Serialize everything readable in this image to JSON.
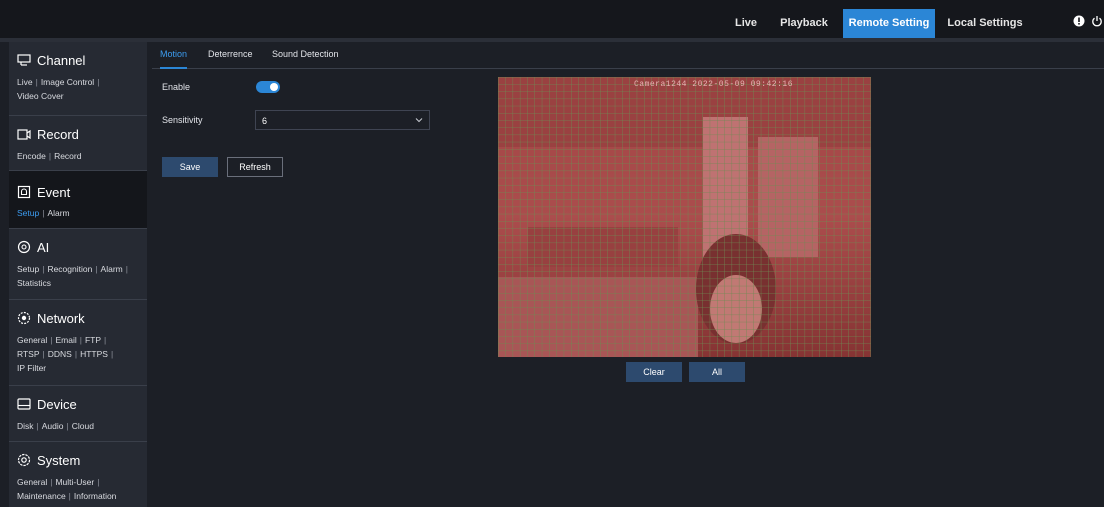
{
  "top_nav": {
    "items": [
      {
        "label": "Live",
        "active": false
      },
      {
        "label": "Playback",
        "active": false
      },
      {
        "label": "Remote Setting",
        "active": true
      },
      {
        "label": "Local Settings",
        "active": false
      }
    ],
    "icons": [
      "info-icon",
      "power-icon"
    ]
  },
  "sidebar": {
    "sections": [
      {
        "title": "Channel",
        "icon": "channel-icon",
        "links": [
          {
            "label": "Live",
            "active": false
          },
          {
            "label": "Image Control",
            "active": false
          },
          {
            "label": "Video Cover",
            "active": false
          }
        ]
      },
      {
        "title": "Record",
        "icon": "record-icon",
        "links": [
          {
            "label": "Encode",
            "active": false
          },
          {
            "label": "Record",
            "active": false
          }
        ]
      },
      {
        "title": "Event",
        "icon": "event-icon",
        "active": true,
        "links": [
          {
            "label": "Setup",
            "active": true
          },
          {
            "label": "Alarm",
            "active": false
          }
        ]
      },
      {
        "title": "AI",
        "icon": "ai-icon",
        "links": [
          {
            "label": "Setup",
            "active": false
          },
          {
            "label": "Recognition",
            "active": false
          },
          {
            "label": "Alarm",
            "active": false
          },
          {
            "label": "Statistics",
            "active": false
          }
        ]
      },
      {
        "title": "Network",
        "icon": "network-icon",
        "links": [
          {
            "label": "General",
            "active": false
          },
          {
            "label": "Email",
            "active": false
          },
          {
            "label": "FTP",
            "active": false
          },
          {
            "label": "RTSP",
            "active": false
          },
          {
            "label": "DDNS",
            "active": false
          },
          {
            "label": "HTTPS",
            "active": false
          },
          {
            "label": "IP Filter",
            "active": false
          }
        ]
      },
      {
        "title": "Device",
        "icon": "device-icon",
        "links": [
          {
            "label": "Disk",
            "active": false
          },
          {
            "label": "Audio",
            "active": false
          },
          {
            "label": "Cloud",
            "active": false
          }
        ]
      },
      {
        "title": "System",
        "icon": "system-icon",
        "links": [
          {
            "label": "General",
            "active": false
          },
          {
            "label": "Multi-User",
            "active": false
          },
          {
            "label": "Maintenance",
            "active": false
          },
          {
            "label": "Information",
            "active": false
          }
        ]
      }
    ]
  },
  "tabs": [
    {
      "label": "Motion",
      "active": true
    },
    {
      "label": "Deterrence",
      "active": false
    },
    {
      "label": "Sound Detection",
      "active": false
    }
  ],
  "form": {
    "enable_label": "Enable",
    "enable_value": true,
    "sensitivity_label": "Sensitivity",
    "sensitivity_value": "6",
    "save_label": "Save",
    "refresh_label": "Refresh"
  },
  "video": {
    "overlay": "Camera1244 2022-05-09 09:42:16",
    "clear_label": "Clear",
    "all_label": "All"
  },
  "colors": {
    "accent": "#2b86d6",
    "active_link": "#3c9cf0",
    "topbar": "#15171c",
    "panel": "#1c1f26",
    "sidebar": "#262a33",
    "grid_line": "#5f7d4a",
    "grid_fill": "#b23c3c"
  }
}
